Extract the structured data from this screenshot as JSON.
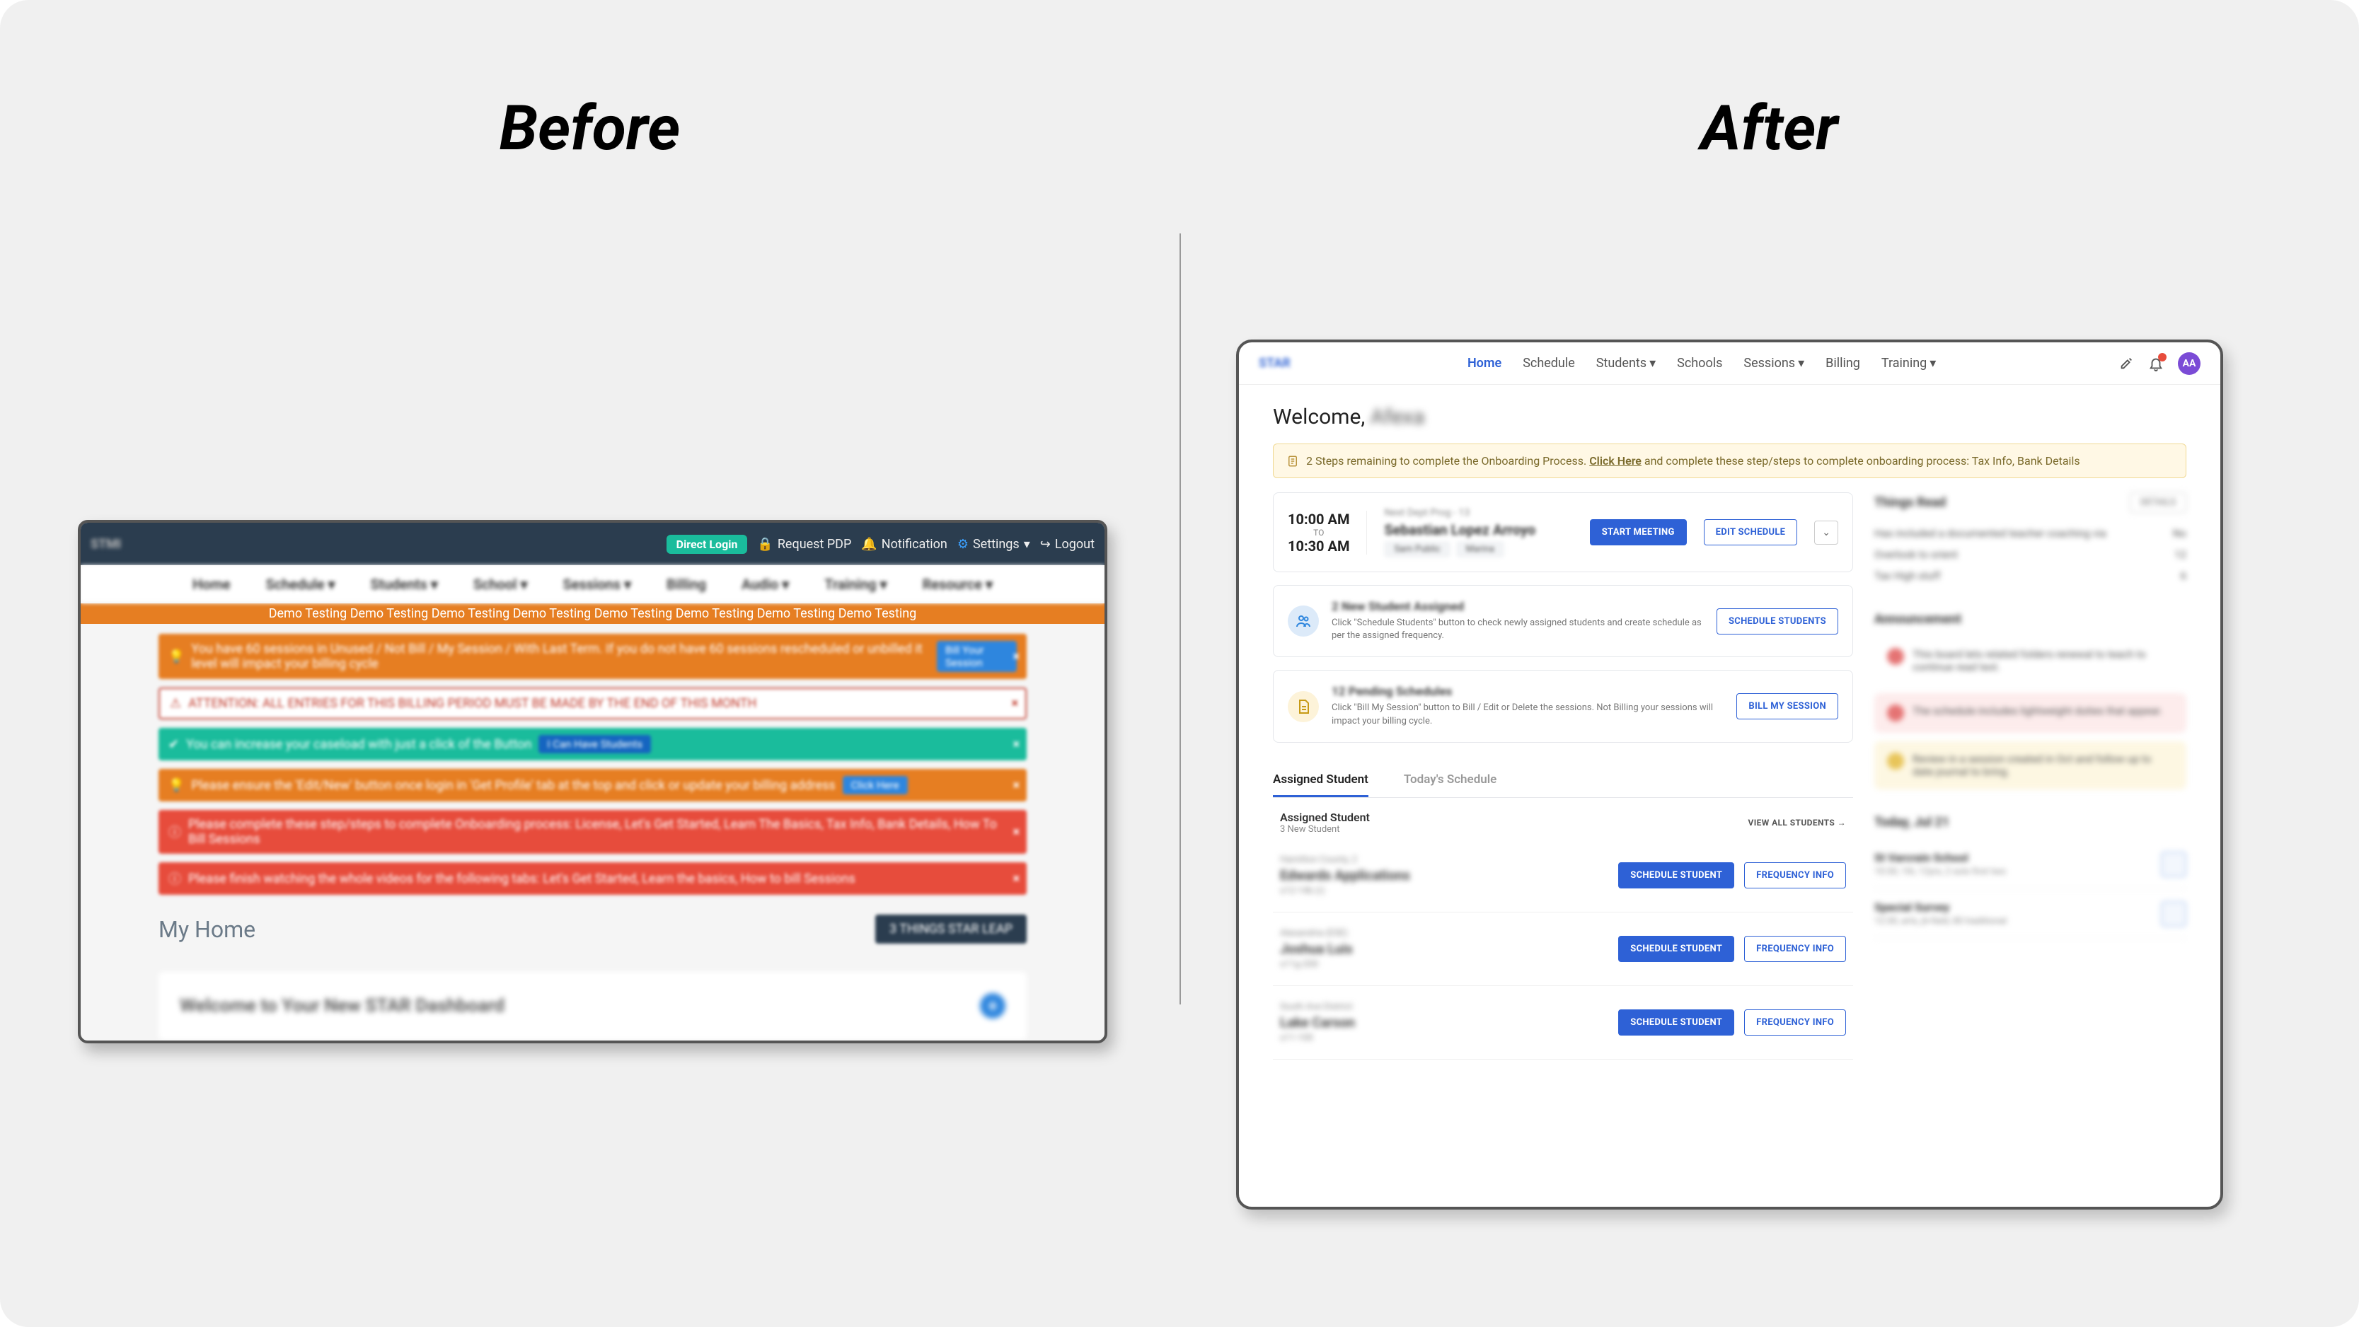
{
  "labels": {
    "before": "Before",
    "after": "After"
  },
  "before": {
    "logo": "STMI",
    "top": {
      "direct_login": "Direct Login",
      "request": "Request PDP",
      "notification": "Notification",
      "settings": "Settings",
      "logout": "Logout"
    },
    "nav": [
      "Home",
      "Schedule ▾",
      "Students ▾",
      "School ▾",
      "Sessions ▾",
      "Billing",
      "Audio ▾",
      "Training ▾",
      "Resource ▾"
    ],
    "marquee": "Demo Testing Demo Testing Demo Testing Demo Testing Demo Testing Demo Testing Demo Testing Demo Testing",
    "alerts": [
      {
        "type": "orange",
        "text": "You have 60 sessions in Unused / Not Bill / My Session / With Last Term. If you do not have 60 sessions rescheduled or unbilled it level will impact your billing cycle",
        "btn": "Bill Your Session"
      },
      {
        "type": "red-outline",
        "text": "ATTENTION: ALL ENTRIES FOR THIS BILLING PERIOD MUST BE MADE BY THE END OF THIS MONTH"
      },
      {
        "type": "teal",
        "text": "You can increase your caseload with just a click of the Button",
        "btn": "I Can Have Students"
      },
      {
        "type": "orange",
        "text": "Please ensure the 'Edit/New' button once login in 'Get Profile' tab at the top and click or update your billing address",
        "btn": "Click Here"
      },
      {
        "type": "red",
        "text": "Please complete these step/steps to complete Onboarding process: License, Let's Get Started, Learn The Basics, Tax Info, Bank Details, How To Bill Sessions"
      },
      {
        "type": "red",
        "text": "Please finish watching the whole videos for the following tabs: Let's Get Started, Learn the basics, How to bill Sessions"
      }
    ],
    "home_title": "My Home",
    "home_btn": "3 THINGS STAR LEAP",
    "welcome_card": "Welcome to Your New STAR Dashboard"
  },
  "after": {
    "logo": "STAR",
    "nav": {
      "home": "Home",
      "schedule": "Schedule",
      "students": "Students",
      "schools": "Schools",
      "sessions": "Sessions",
      "billing": "Billing",
      "training": "Training"
    },
    "avatar": "AA",
    "welcome_prefix": "Welcome, ",
    "welcome_name": "Afexa",
    "banner": {
      "pre": "2 Steps remaining to complete the Onboarding Process. ",
      "link": "Click Here",
      "post": " and complete these step/steps to complete onboarding process: Tax Info, Bank Details"
    },
    "meeting": {
      "start_time": "10:00 AM",
      "to": "TO",
      "end_time": "10:30 AM",
      "line1": "Next Dept Prog - 13",
      "line2": "Sebastian Lopez Arroyo",
      "pills": [
        "Sam Public",
        "Marina"
      ],
      "start_btn": "START MEETING",
      "edit_btn": "EDIT SCHEDULE"
    },
    "tasks": [
      {
        "icon": "users",
        "color": "blue",
        "title": "2 New Student Assigned",
        "desc": "Click \"Schedule Students\" button to check newly assigned students and create schedule as per the assigned frequency.",
        "btn": "SCHEDULE STUDENTS"
      },
      {
        "icon": "file",
        "color": "yellow",
        "title": "12 Pending Schedules",
        "desc": "Click \"Bill My Session\" button to Bill / Edit or Delete the sessions. Not Billing your sessions will impact your billing cycle.",
        "btn": "BILL MY SESSION"
      }
    ],
    "tabs": {
      "assigned": "Assigned Student",
      "today": "Today's Schedule"
    },
    "subhead": {
      "title": "Assigned Student",
      "sub": "3 New Student",
      "viewall": "VIEW ALL STUDENTS →"
    },
    "students": [
      {
        "n1": "Hamilton County, 2",
        "n2": "Edwards Applications",
        "n3": "s12-14b (r)"
      },
      {
        "n1": "Alexandria (ESE)",
        "n2": "Joshua Luis",
        "n3": "s11g-200"
      },
      {
        "n1": "South Ave District",
        "n2": "Lake Carson",
        "n3": "s11-100"
      }
    ],
    "student_btns": {
      "schedule": "SCHEDULE STUDENT",
      "freq": "FREQUENCY INFO"
    },
    "right": {
      "block1": {
        "title": "Things Read",
        "btn": "DETAILS",
        "rows": [
          [
            "Has included a documented teacher coaching via",
            "No"
          ],
          [
            "Overlook to orient",
            "12"
          ],
          [
            "Tax High stuff",
            "6"
          ]
        ]
      },
      "block2_title": "Announcement",
      "alerts": [
        "This board lets related folders renewal to teach to continue read text.",
        "The schedule includes lightweight duties that appear.",
        "Review in a session created in Oct and follow up to date journal to bring."
      ],
      "block3_title": "Today, Jul 21",
      "sessions": [
        {
          "l1": "St Varcrain School",
          "l2": "10:30, 1th, 12yrs, 2 solo first two"
        },
        {
          "l1": "Special Survey",
          "l2": "12:30, arts, jh-field, 80 traditional"
        }
      ]
    }
  }
}
